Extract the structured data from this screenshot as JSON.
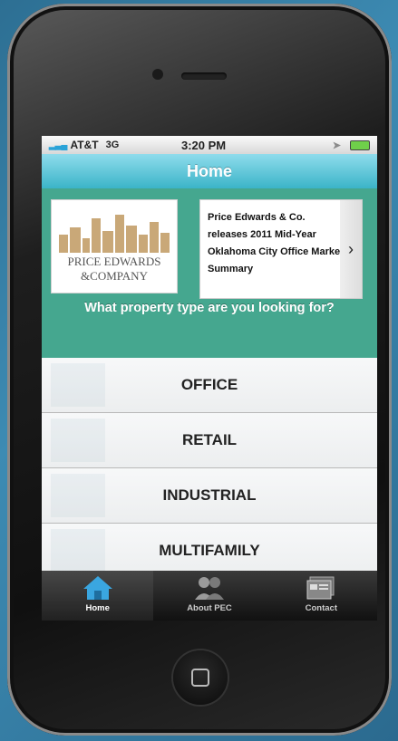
{
  "status_bar": {
    "carrier": "AT&T",
    "network": "3G",
    "time": "3:20 PM"
  },
  "nav": {
    "title": "Home"
  },
  "logo": {
    "line1": "PRICE EDWARDS",
    "line2": "&COMPANY"
  },
  "news": {
    "headline": "Price Edwards & Co. releases 2011 Mid-Year Oklahoma City Office Market Summary"
  },
  "question": "What property type are you looking for?",
  "property_types": [
    "OFFICE",
    "RETAIL",
    "INDUSTRIAL",
    "MULTIFAMILY"
  ],
  "tabs": [
    {
      "label": "Home",
      "icon": "house-icon"
    },
    {
      "label": "About PEC",
      "icon": "people-icon"
    },
    {
      "label": "Contact",
      "icon": "contact-card-icon"
    }
  ],
  "colors": {
    "accent": "#45a78f",
    "nav": "#3bb4c8",
    "active_tab_icon": "#3aa6e0"
  }
}
